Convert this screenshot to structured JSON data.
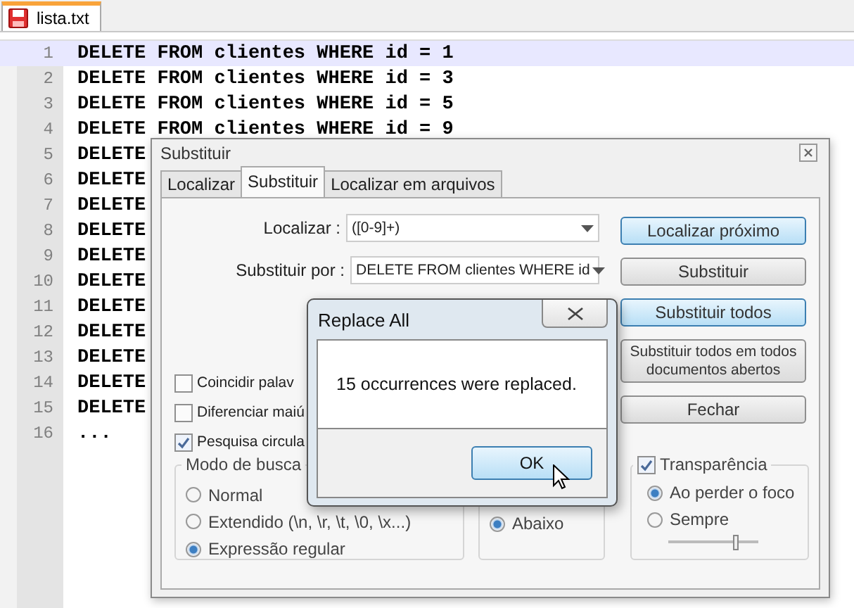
{
  "tab": {
    "label": "lista.txt",
    "selected": true
  },
  "editor": {
    "lines": [
      {
        "number": "1",
        "text": "DELETE FROM clientes WHERE id = 1",
        "current": true
      },
      {
        "number": "2",
        "text": "DELETE FROM clientes WHERE id = 3",
        "current": false
      },
      {
        "number": "3",
        "text": "DELETE FROM clientes WHERE id = 5",
        "current": false
      },
      {
        "number": "4",
        "text": "DELETE FROM clientes WHERE id = 9",
        "current": false
      },
      {
        "number": "5",
        "text": "DELETE",
        "current": false
      },
      {
        "number": "6",
        "text": "DELETE",
        "current": false
      },
      {
        "number": "7",
        "text": "DELETE",
        "current": false
      },
      {
        "number": "8",
        "text": "DELETE",
        "current": false
      },
      {
        "number": "9",
        "text": "DELETE",
        "current": false
      },
      {
        "number": "10",
        "text": "DELETE",
        "current": false
      },
      {
        "number": "11",
        "text": "DELETE",
        "current": false
      },
      {
        "number": "12",
        "text": "DELETE",
        "current": false
      },
      {
        "number": "13",
        "text": "DELETE",
        "current": false
      },
      {
        "number": "14",
        "text": "DELETE",
        "current": false
      },
      {
        "number": "15",
        "text": "DELETE",
        "current": false
      },
      {
        "number": "16",
        "text": "...",
        "current": false
      }
    ]
  },
  "replace_dialog": {
    "title": "Substituir",
    "tabs": [
      {
        "label": "Localizar",
        "selected": false
      },
      {
        "label": "Substituir",
        "selected": true
      },
      {
        "label": "Localizar em arquivos",
        "selected": false
      }
    ],
    "find": {
      "label": "Localizar :",
      "value": "([0-9]+)"
    },
    "replace": {
      "label": "Substituir por :",
      "value": "DELETE FROM clientes WHERE id"
    },
    "buttons": [
      {
        "label": "Localizar próximo",
        "highlighted": true
      },
      {
        "label": "Substituir",
        "highlighted": false
      },
      {
        "label": "Substituir todos",
        "highlighted": true
      },
      {
        "label": "Substituir todos em todos documentos abertos",
        "highlighted": false
      },
      {
        "label": "Fechar",
        "highlighted": false
      }
    ],
    "options": [
      {
        "label": "Coincidir palav",
        "checked": false
      },
      {
        "label": "Diferenciar maiú",
        "checked": false
      },
      {
        "label": "Pesquisa circula",
        "checked": true
      }
    ],
    "search_mode": {
      "title": "Modo de busca",
      "options": [
        {
          "label": "Normal",
          "selected": false
        },
        {
          "label": "Extendido  (\\n, \\r, \\t, \\0, \\x...)",
          "selected": false
        },
        {
          "label": "Expressão regular",
          "selected": true
        }
      ]
    },
    "direction": {
      "options": [
        {
          "label": "Abaixo",
          "selected": true
        }
      ]
    },
    "transparency": {
      "label": "Transparência",
      "checked": true,
      "options": [
        {
          "label": "Ao perder o foco",
          "selected": true
        },
        {
          "label": "Sempre",
          "selected": false
        }
      ],
      "level": 0.75
    }
  },
  "message_box": {
    "title": "Replace All",
    "message": "15 occurrences were replaced.",
    "button": "OK"
  }
}
